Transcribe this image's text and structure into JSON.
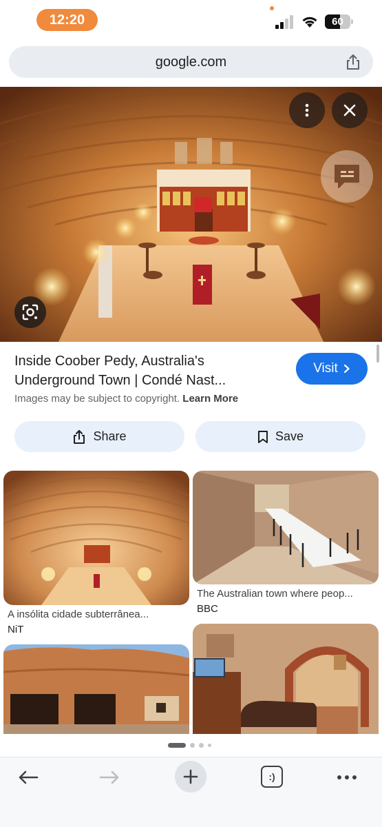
{
  "status_bar": {
    "time": "12:20",
    "battery_level": "60",
    "battery_fraction": 0.6,
    "icons": [
      "signal-icon",
      "wifi-icon",
      "battery-icon"
    ]
  },
  "browser": {
    "url": "google.com",
    "share_icon": "share-icon"
  },
  "hero": {
    "controls": [
      "more-options-icon",
      "close-icon",
      "feedback-icon",
      "google-lens-icon"
    ]
  },
  "result": {
    "title_line1": "Inside Coober Pedy, Australia's",
    "title_line2": "Underground Town | Condé Nast...",
    "visit_label": "Visit",
    "copyright_text": "Images may be subject to copyright.",
    "learn_more": "Learn More",
    "share_label": "Share",
    "save_label": "Save"
  },
  "related": [
    {
      "caption": "A insólita cidade subterrânea...",
      "source": "NiT"
    },
    {
      "caption": "The Australian town where peop...",
      "source": "BBC"
    },
    {
      "caption": "",
      "source": ""
    },
    {
      "caption": "",
      "source": ""
    }
  ],
  "pagination": {
    "active_page": 1,
    "total_pages": 4
  },
  "bottom_nav": {
    "tab_count": ":)",
    "icons": [
      "back-icon",
      "forward-icon",
      "new-tab-icon",
      "tabs-icon",
      "more-icon"
    ]
  },
  "colors": {
    "accent_blue": "#1a73e8",
    "time_pill": "#f08a3c",
    "action_button_bg": "#e8f0fb",
    "url_bar_bg": "#e9edf1"
  }
}
